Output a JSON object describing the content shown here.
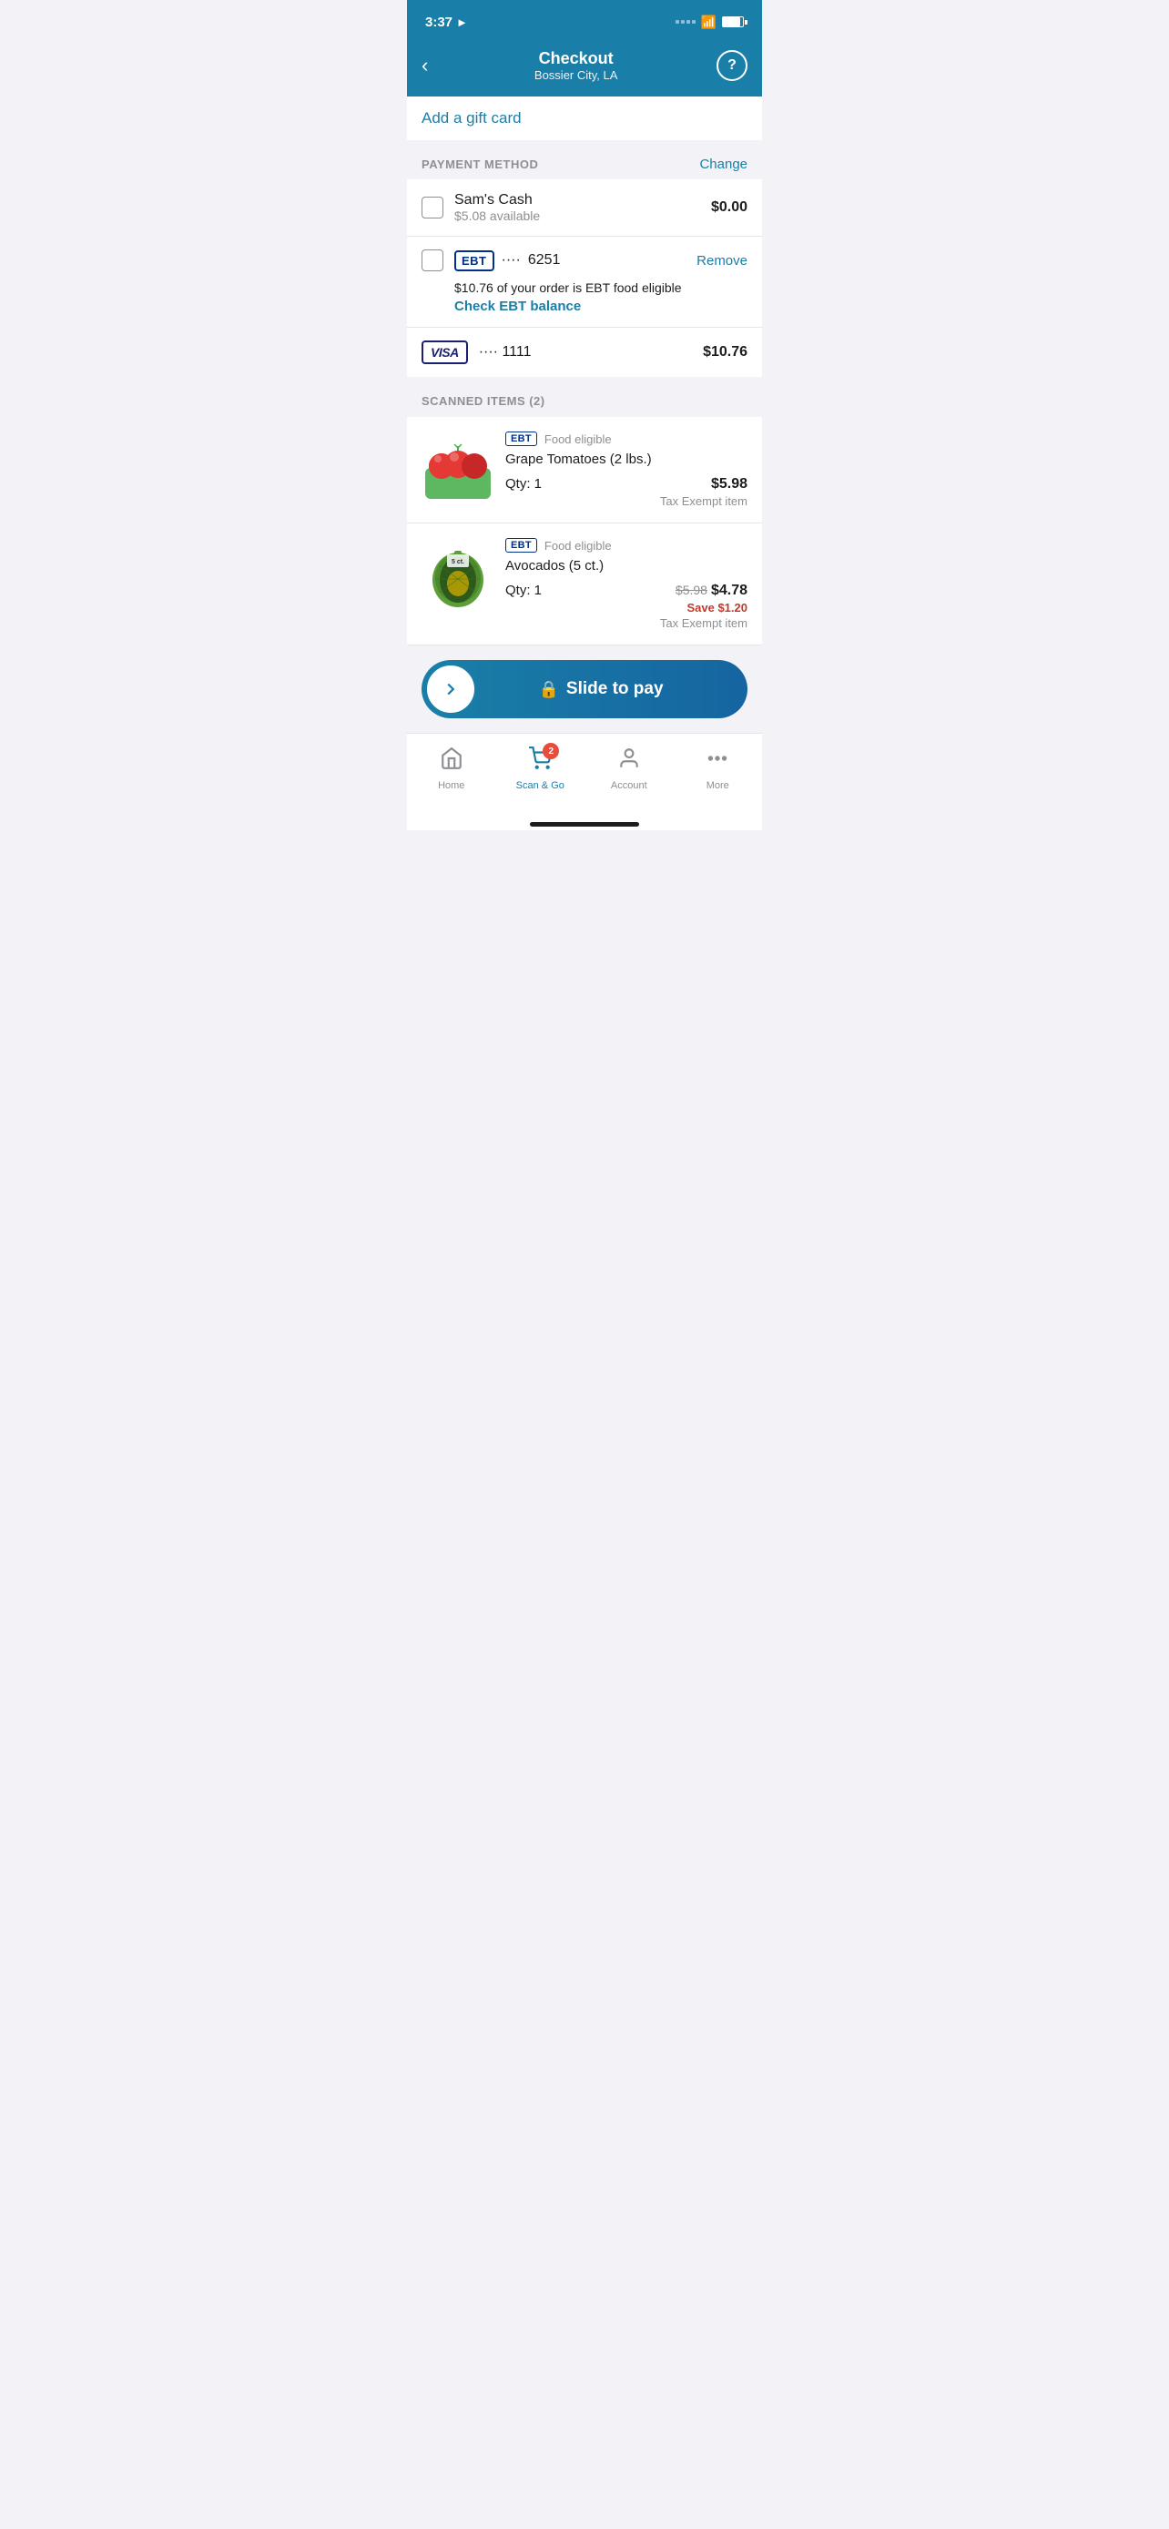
{
  "statusBar": {
    "time": "3:37",
    "locationIcon": "►"
  },
  "header": {
    "title": "Checkout",
    "subtitle": "Bossier City, LA",
    "backLabel": "‹",
    "helpLabel": "?"
  },
  "giftCard": {
    "linkText": "Add a gift card"
  },
  "paymentMethod": {
    "sectionLabel": "PAYMENT METHOD",
    "changeLabel": "Change",
    "samsCash": {
      "name": "Sam's Cash",
      "available": "$5.08 available",
      "amount": "$0.00"
    },
    "ebt": {
      "badgeText": "EBT",
      "dots": "····",
      "lastFour": "6251",
      "removeLabel": "Remove",
      "eligibleText": "$10.76 of your order is EBT food eligible",
      "balanceLinkText": "Check EBT balance"
    },
    "visa": {
      "badgeText": "VISA",
      "dots": "····",
      "lastFour": "1111",
      "amount": "$10.76"
    }
  },
  "scannedItems": {
    "sectionLabel": "SCANNED ITEMS (2)",
    "items": [
      {
        "id": "item-1",
        "ebtTag": "EBT",
        "foodEligible": "Food eligible",
        "name": "Grape Tomatoes (2 lbs.)",
        "qty": "Qty: 1",
        "price": "$5.98",
        "originalPrice": null,
        "savingsText": null,
        "taxNote": "Tax Exempt item",
        "imageType": "tomatoes"
      },
      {
        "id": "item-2",
        "ebtTag": "EBT",
        "foodEligible": "Food eligible",
        "name": "Avocados (5 ct.)",
        "qty": "Qty: 1",
        "price": "$4.78",
        "originalPrice": "$5.98",
        "savingsText": "Save $1.20",
        "taxNote": "Tax Exempt item",
        "imageType": "avocados"
      }
    ]
  },
  "slideToPay": {
    "label": "Slide to pay"
  },
  "bottomNav": {
    "items": [
      {
        "id": "home",
        "label": "Home",
        "active": false,
        "badge": null
      },
      {
        "id": "scan-go",
        "label": "Scan & Go",
        "active": true,
        "badge": "2"
      },
      {
        "id": "account",
        "label": "Account",
        "active": false,
        "badge": null
      },
      {
        "id": "more",
        "label": "More",
        "active": false,
        "badge": null
      }
    ]
  }
}
